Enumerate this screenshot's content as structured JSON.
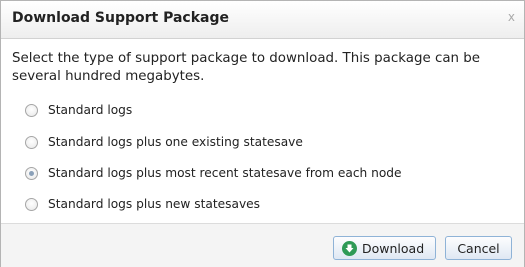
{
  "dialog": {
    "title": "Download Support Package",
    "close_label": "x",
    "intro": "Select the type of support package to download. This package can be several hundred megabytes.",
    "options": [
      {
        "label": "Standard logs",
        "selected": false
      },
      {
        "label": "Standard logs plus one existing statesave",
        "selected": false
      },
      {
        "label": "Standard logs plus most recent statesave from each node",
        "selected": true
      },
      {
        "label": "Standard logs plus new statesaves",
        "selected": false
      }
    ],
    "buttons": {
      "download_label": "Download",
      "download_icon": "download-arrow-icon",
      "cancel_label": "Cancel"
    }
  }
}
